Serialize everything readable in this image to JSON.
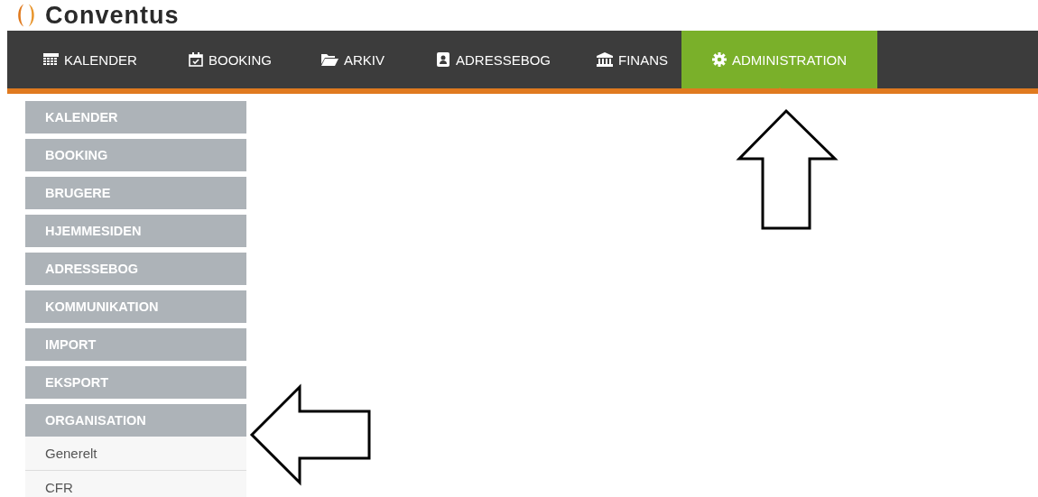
{
  "logo": {
    "text": "Conventus"
  },
  "nav": {
    "items": [
      {
        "label": "KALENDER",
        "selected": false
      },
      {
        "label": "BOOKING",
        "selected": false
      },
      {
        "label": "ARKIV",
        "selected": false
      },
      {
        "label": "ADRESSEBOG",
        "selected": false
      },
      {
        "label": "FINANS",
        "selected": false
      },
      {
        "label": "ADMINISTRATION",
        "selected": true
      }
    ]
  },
  "sidebar": {
    "items": [
      {
        "label": "KALENDER",
        "expanded": false
      },
      {
        "label": "BOOKING",
        "expanded": false
      },
      {
        "label": "BRUGERE",
        "expanded": false
      },
      {
        "label": "HJEMMESIDEN",
        "expanded": false
      },
      {
        "label": "ADRESSEBOG",
        "expanded": false
      },
      {
        "label": "KOMMUNIKATION",
        "expanded": false
      },
      {
        "label": "IMPORT",
        "expanded": false
      },
      {
        "label": "EKSPORT",
        "expanded": false
      },
      {
        "label": "ORGANISATION",
        "expanded": true,
        "children": [
          {
            "label": "Generelt"
          },
          {
            "label": "CFR"
          }
        ]
      }
    ]
  }
}
